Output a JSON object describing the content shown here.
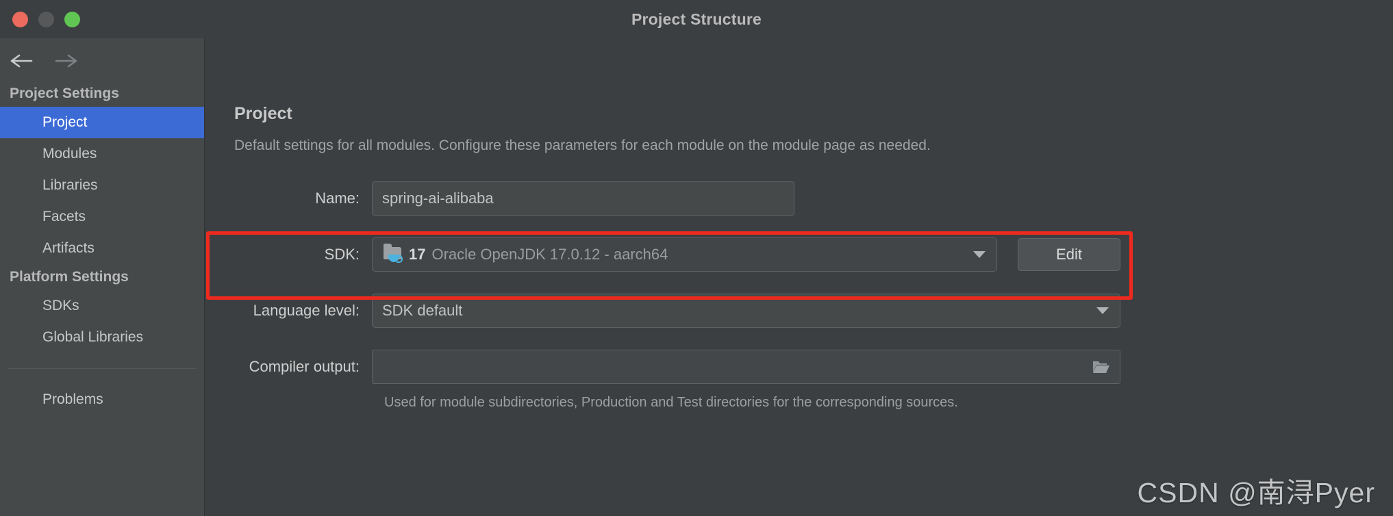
{
  "window": {
    "title": "Project Structure",
    "traffic_lights": [
      {
        "name": "close",
        "color": "#ec6a5e"
      },
      {
        "name": "minimize",
        "color": "#57585a"
      },
      {
        "name": "zoom",
        "color": "#61c554"
      }
    ]
  },
  "nav": {
    "back_icon": "arrow-left-icon",
    "forward_icon": "arrow-right-icon"
  },
  "sidebar": {
    "groups": [
      {
        "title": "Project Settings",
        "items": [
          {
            "label": "Project",
            "selected": true
          },
          {
            "label": "Modules",
            "selected": false
          },
          {
            "label": "Libraries",
            "selected": false
          },
          {
            "label": "Facets",
            "selected": false
          },
          {
            "label": "Artifacts",
            "selected": false
          }
        ]
      },
      {
        "title": "Platform Settings",
        "items": [
          {
            "label": "SDKs",
            "selected": false
          },
          {
            "label": "Global Libraries",
            "selected": false
          }
        ]
      }
    ],
    "footer_items": [
      {
        "label": "Problems",
        "selected": false
      }
    ],
    "selected_accent": "#3d6bd6"
  },
  "main": {
    "section_title": "Project",
    "section_desc": "Default settings for all modules. Configure these parameters for each module on the module page as needed.",
    "fields": {
      "name": {
        "label": "Name:",
        "value": "spring-ai-alibaba",
        "placeholder": ""
      },
      "sdk": {
        "label": "SDK:",
        "icon": "java-sdk-folder-icon",
        "version": "17",
        "value": "Oracle OpenJDK 17.0.12 - aarch64",
        "edit_button": "Edit",
        "caret": "chevron-down-icon"
      },
      "language_level": {
        "label": "Language level:",
        "value": "SDK default",
        "caret": "chevron-down-icon"
      },
      "compiler_output": {
        "label": "Compiler output:",
        "value": "",
        "placeholder": "",
        "browse_icon": "folder-open-icon",
        "helper": "Used for module subdirectories, Production and Test directories for the corresponding sources."
      }
    }
  },
  "annotation": {
    "highlight_color": "#ee2a1e",
    "target": "sdk-row"
  },
  "watermark": {
    "text": "CSDN @南浔Pyer"
  }
}
